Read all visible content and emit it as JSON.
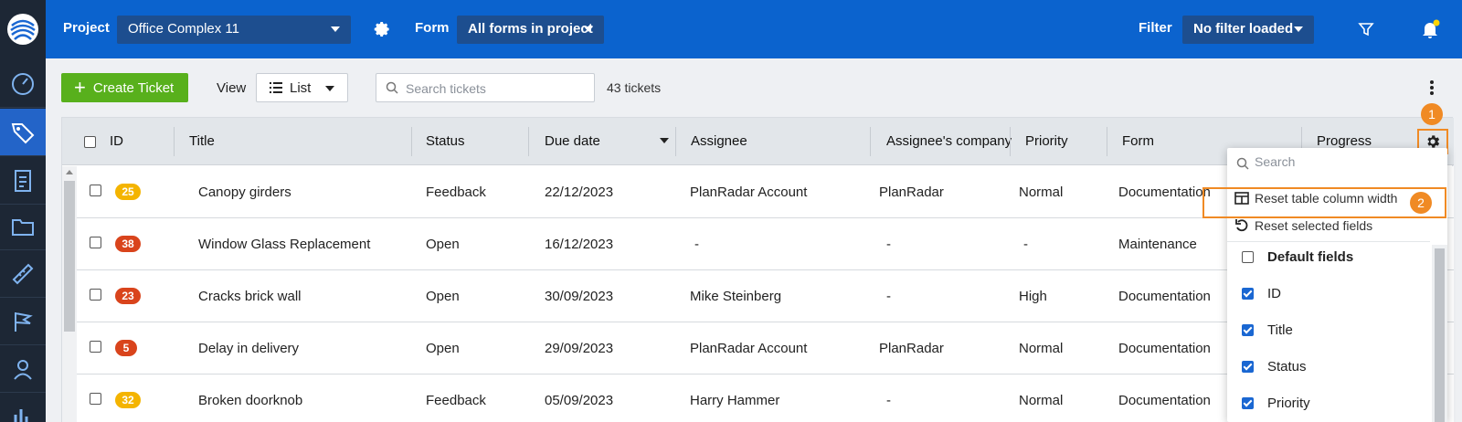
{
  "header": {
    "project_label": "Project",
    "project_value": "Office Complex 11",
    "form_label": "Form",
    "form_value": "All forms in project",
    "filter_label": "Filter",
    "filter_value": "No filter loaded"
  },
  "sidebar": {
    "items": [
      "logo-icon",
      "dashboard-icon",
      "tickets-icon",
      "forms-icon",
      "folder-icon",
      "ruler-icon",
      "flag-icon",
      "user-icon",
      "reports-icon"
    ],
    "active_index": 2
  },
  "toolbar": {
    "create_label": "Create Ticket",
    "view_label": "View",
    "view_value": "List",
    "search_placeholder": "Search tickets",
    "ticket_count": "43 tickets"
  },
  "table": {
    "columns": [
      "ID",
      "Title",
      "Status",
      "Due date",
      "Assignee",
      "Assignee's company",
      "Priority",
      "Form",
      "Progress"
    ],
    "rows": [
      {
        "id": "25",
        "id_color": "#f4b400",
        "title": "Canopy girders",
        "status": "Feedback",
        "due": "22/12/2023",
        "assignee": "PlanRadar Account",
        "company": "PlanRadar",
        "priority": "Normal",
        "form": "Documentation"
      },
      {
        "id": "38",
        "id_color": "#d9441c",
        "title": "Window Glass Replacement",
        "status": "Open",
        "due": "16/12/2023",
        "assignee": "-",
        "company": "-",
        "priority": "-",
        "form": "Maintenance"
      },
      {
        "id": "23",
        "id_color": "#d9441c",
        "title": "Cracks brick wall",
        "status": "Open",
        "due": "30/09/2023",
        "assignee": "Mike Steinberg",
        "company": "-",
        "priority": "High",
        "form": "Documentation"
      },
      {
        "id": "5",
        "id_color": "#d9441c",
        "title": "Delay in delivery",
        "status": "Open",
        "due": "29/09/2023",
        "assignee": "PlanRadar Account",
        "company": "PlanRadar",
        "priority": "Normal",
        "form": "Documentation"
      },
      {
        "id": "32",
        "id_color": "#f4b400",
        "title": "Broken doorknob",
        "status": "Feedback",
        "due": "05/09/2023",
        "assignee": "Harry Hammer",
        "company": "-",
        "priority": "Normal",
        "form": "Documentation"
      }
    ]
  },
  "column_panel": {
    "search_placeholder": "Search",
    "reset_width": "Reset table column width",
    "reset_fields": "Reset selected fields",
    "fields": [
      {
        "label": "Default fields",
        "checked": false,
        "bold": true
      },
      {
        "label": "ID",
        "checked": true
      },
      {
        "label": "Title",
        "checked": true
      },
      {
        "label": "Status",
        "checked": true
      },
      {
        "label": "Priority",
        "checked": true
      }
    ]
  },
  "callouts": [
    "1",
    "2"
  ],
  "colors": {
    "header_bg": "#0b63ce",
    "sidebar_bg": "#1d2735",
    "accent_orange": "#f08a24",
    "create_green": "#58b01c",
    "checkbox_blue": "#1a67d2"
  }
}
